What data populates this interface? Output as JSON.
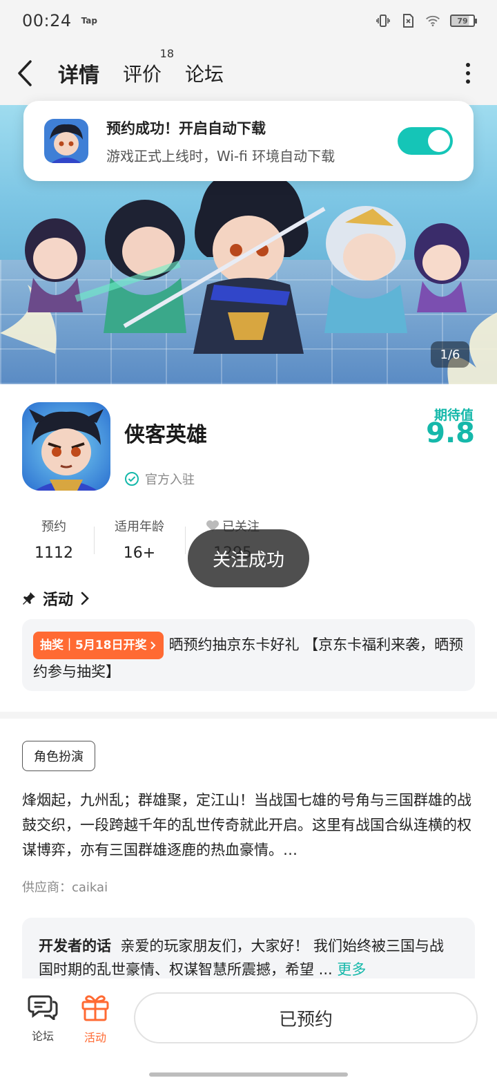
{
  "status_bar": {
    "time": "00:24",
    "app_badge": "Tap",
    "battery": "79"
  },
  "header": {
    "tabs": [
      {
        "label": "详情",
        "active": true
      },
      {
        "label": "评价",
        "badge": "18"
      },
      {
        "label": "论坛"
      }
    ]
  },
  "notification": {
    "title": "预约成功！开启自动下载",
    "subtitle": "游戏正式上线时，Wi-fi 环境自动下载",
    "toggle_on": true
  },
  "banner": {
    "counter": "1/6"
  },
  "app": {
    "name": "侠客英雄",
    "verified": "官方入驻",
    "expect_label": "期待值",
    "expect_value": "9.8"
  },
  "stats": [
    {
      "label": "预约",
      "value": "1112"
    },
    {
      "label": "适用年龄",
      "value": "16+"
    },
    {
      "label": "已关注",
      "value": "1295"
    }
  ],
  "toast": "关注成功",
  "activities": {
    "title": "活动",
    "tag": "抽奖｜5月18日开奖",
    "text": "晒预约抽京东卡好礼 【京东卡福利来袭，晒预约参与抽奖】"
  },
  "genre": "角色扮演",
  "description": "烽烟起，九州乱；群雄聚，定江山！当战国七雄的号角与三国群雄的战鼓交织，一段跨越千年的乱世传奇就此开启。这里有战国合纵连横的权谋博弈，亦有三国群雄逐鹿的热血豪情。…",
  "supplier": "供应商：caikai",
  "developer": {
    "heading": "开发者的话",
    "text": "亲爱的玩家朋友们，大家好！ 我们始终被三国与战国时期的乱世豪情、权谋智慧所震撼，希望 ...",
    "more": "更多"
  },
  "bottom_bar": {
    "forum": "论坛",
    "activity": "活动",
    "reserve": "已预约"
  },
  "colors": {
    "accent": "#15c5b7",
    "orange": "#ff6a33"
  }
}
